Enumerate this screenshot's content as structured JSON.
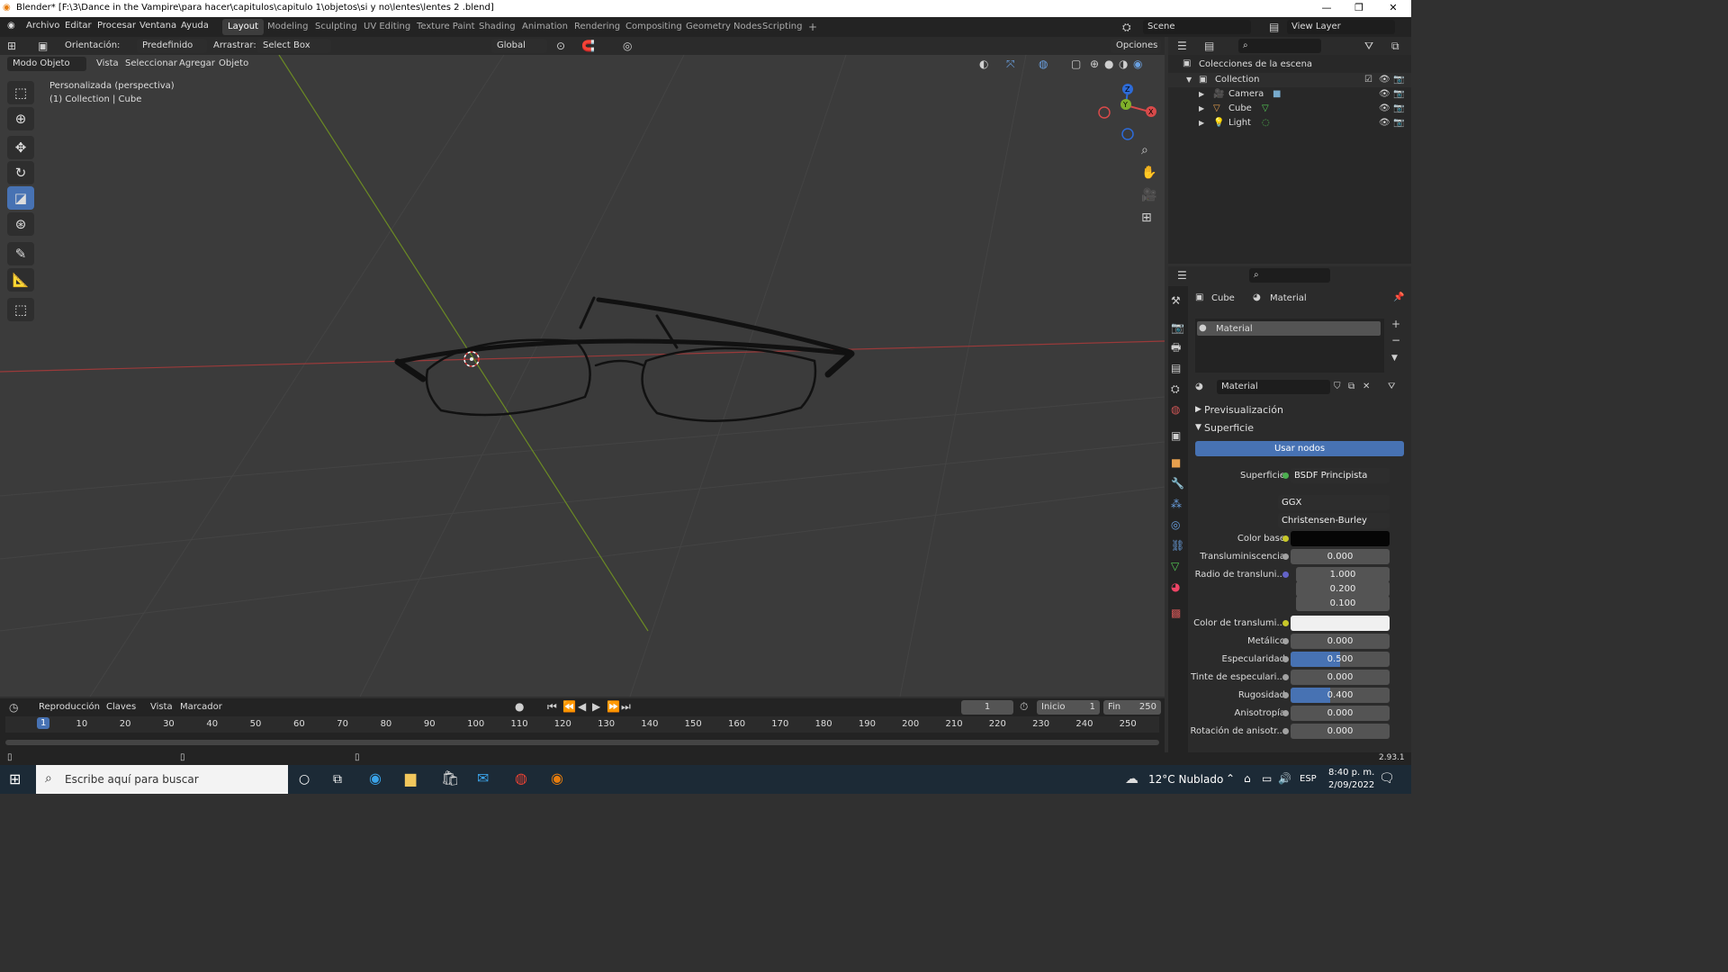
{
  "titlebar": {
    "title": "Blender* [F:\\3\\Dance in the Vampire\\para hacer\\capitulos\\capitulo 1\\objetos\\si y no\\lentes\\lentes 2  .blend]"
  },
  "menu": [
    "Archivo",
    "Editar",
    "Procesar",
    "Ventana",
    "Ayuda"
  ],
  "workspaces": [
    "Layout",
    "Modeling",
    "Sculpting",
    "UV Editing",
    "Texture Paint",
    "Shading",
    "Animation",
    "Rendering",
    "Compositing",
    "Geometry Nodes",
    "Scripting"
  ],
  "scene": {
    "name": "Scene",
    "view_layer": "View Layer"
  },
  "tool_header": {
    "orientation_label": "Orientación:",
    "orientation_value": "Predefinido",
    "drag_label": "Arrastrar:",
    "drag_value": "Select Box",
    "transform": "Global",
    "options": "Opciones"
  },
  "view_header": {
    "mode": "Modo Objeto",
    "items": [
      "Vista",
      "Seleccionar",
      "Agregar",
      "Objeto"
    ]
  },
  "viewport": {
    "view_name": "Personalizada (perspectiva)",
    "collection_info": "(1) Collection | Cube"
  },
  "outliner": {
    "root": "Colecciones de la escena",
    "collection": "Collection",
    "objects": [
      "Camera",
      "Cube",
      "Light"
    ]
  },
  "properties": {
    "breadcrumb_object": "Cube",
    "breadcrumb_material": "Material",
    "slot": "Material",
    "material_name": "Material",
    "panels": {
      "preview": "Previsualización",
      "surface": "Superficie"
    },
    "use_nodes": "Usar nodos",
    "surface_label": "Superficie",
    "surface_value": "BSDF Principista",
    "distribution": "GGX",
    "subsurface_method": "Christensen-Burley",
    "color_base_label": "Color base",
    "color_base": "#050505",
    "trans_label": "Transluminiscencia",
    "trans_value": "0.000",
    "radius_label": "Radio de transluni...",
    "radius_values": [
      "1.000",
      "0.200",
      "0.100"
    ],
    "trans_color_label": "Color de translumi...",
    "trans_color": "#f0f0f0",
    "metal_label": "Metálico",
    "metal_value": "0.000",
    "spec_label": "Especularidad",
    "spec_value": "0.500",
    "spec_fill": 0.5,
    "spec_tint_label": "Tinte de especulari...",
    "spec_tint_value": "0.000",
    "rough_label": "Rugosidad",
    "rough_value": "0.400",
    "rough_fill": 0.4,
    "aniso_label": "Anisotropía",
    "aniso_value": "0.000",
    "aniso_rot_label": "Rotación de anisotr...",
    "aniso_rot_value": "0.000"
  },
  "timeline": {
    "menus": [
      "Reproducción",
      "Claves",
      "Vista",
      "Marcador"
    ],
    "current_frame": "1",
    "start_label": "Inicio",
    "start_value": "1",
    "end_label": "Fin",
    "end_value": "250",
    "ticks": [
      "1",
      "10",
      "20",
      "30",
      "40",
      "50",
      "60",
      "70",
      "80",
      "90",
      "100",
      "110",
      "120",
      "130",
      "140",
      "150",
      "160",
      "170",
      "180",
      "190",
      "200",
      "210",
      "220",
      "230",
      "240",
      "250"
    ]
  },
  "status": {
    "version": "2.93.1"
  },
  "taskbar": {
    "search_placeholder": "Escribe aquí para buscar",
    "weather": "12°C  Nublado",
    "lang": "ESP",
    "time": "8:40 p. m.",
    "date": "2/09/2022"
  }
}
